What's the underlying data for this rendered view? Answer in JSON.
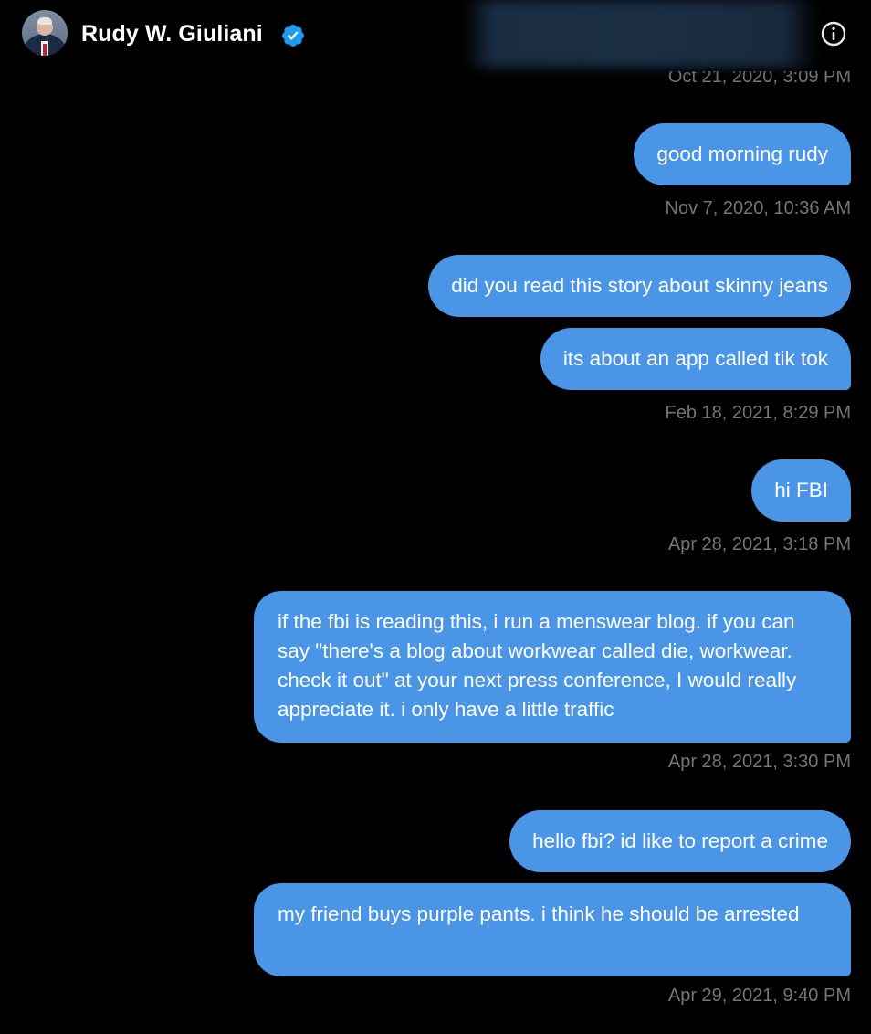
{
  "header": {
    "name": "Rudy W. Giuliani",
    "verified_badge_icon": "verified-badge-icon",
    "info_icon": "info-icon",
    "colors": {
      "background": "#000000",
      "badge": "#1d9bf0"
    }
  },
  "messages": [
    {
      "text": "good morning rudy"
    },
    {
      "text": "did you read this story about skinny jeans"
    },
    {
      "text": "its about an app called tik tok"
    },
    {
      "text": "hi FBI"
    },
    {
      "text": "if the fbi is reading this, i run a menswear blog. if you can say \"there's a blog about workwear called die, workwear. check it out\" at your next press conference, I would really appreciate it. i only have a little traffic"
    },
    {
      "text": "hello fbi? id like to report a crime"
    },
    {
      "text": "my friend buys purple pants. i think he should be arrested"
    }
  ],
  "timestamps": [
    "Oct 21, 2020, 3:09 PM",
    "Nov 7, 2020, 10:36 AM",
    "Feb 18, 2021, 8:29 PM",
    "Apr 28, 2021, 3:18 PM",
    "Apr 28, 2021, 3:30 PM",
    "Apr 29, 2021, 9:40 PM"
  ],
  "colors": {
    "bubble": "#4a95e5",
    "bubble_text": "#ffffff",
    "timestamp": "#71767b"
  }
}
